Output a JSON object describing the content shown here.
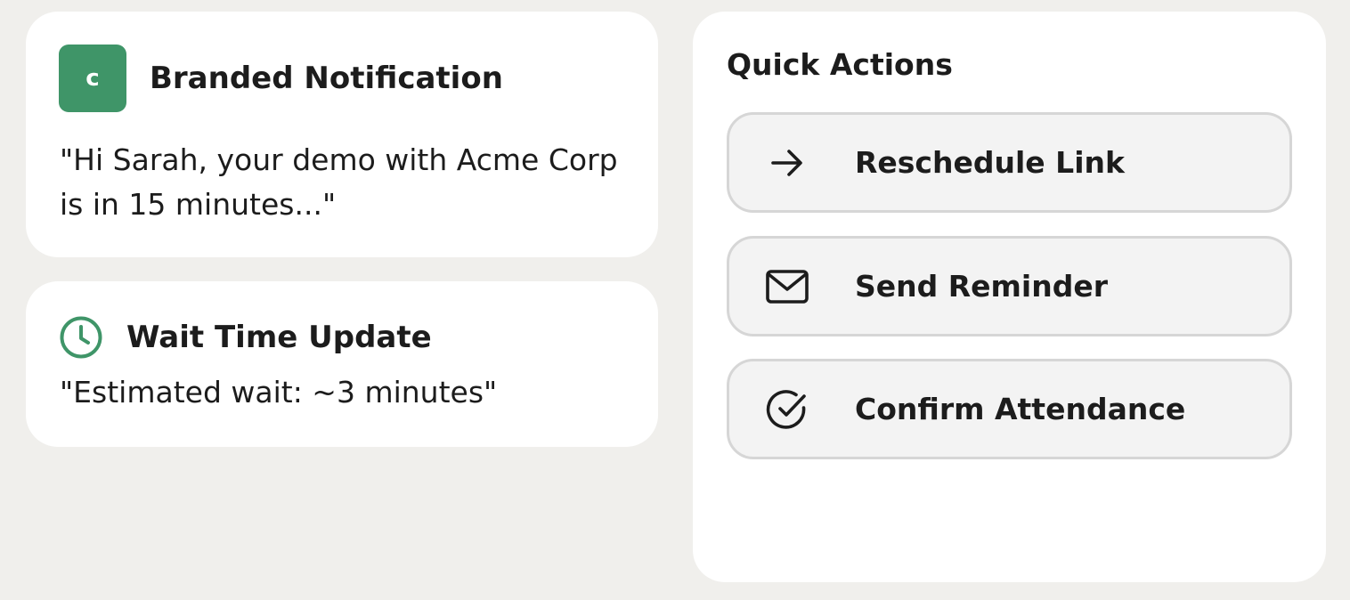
{
  "branded_notification": {
    "logo_letter": "c",
    "title": "Branded Notification",
    "message": "\"Hi Sarah, your demo with Acme Corp is in 15 minutes...\"",
    "brand_color": "#3f9568"
  },
  "wait_time": {
    "icon": "clock-icon",
    "title": "Wait Time Update",
    "message": "\"Estimated wait: ~3 minutes\"",
    "icon_color": "#3f9568"
  },
  "quick_actions": {
    "title": "Quick Actions",
    "items": [
      {
        "icon": "arrow-right-icon",
        "label": "Reschedule Link"
      },
      {
        "icon": "mail-icon",
        "label": "Send Reminder"
      },
      {
        "icon": "check-circle-icon",
        "label": "Confirm Attendance"
      }
    ]
  },
  "colors": {
    "background": "#f0efec",
    "card": "#ffffff",
    "button_bg": "#f3f3f3",
    "button_border": "#d6d6d6",
    "text": "#1c1c1c"
  }
}
